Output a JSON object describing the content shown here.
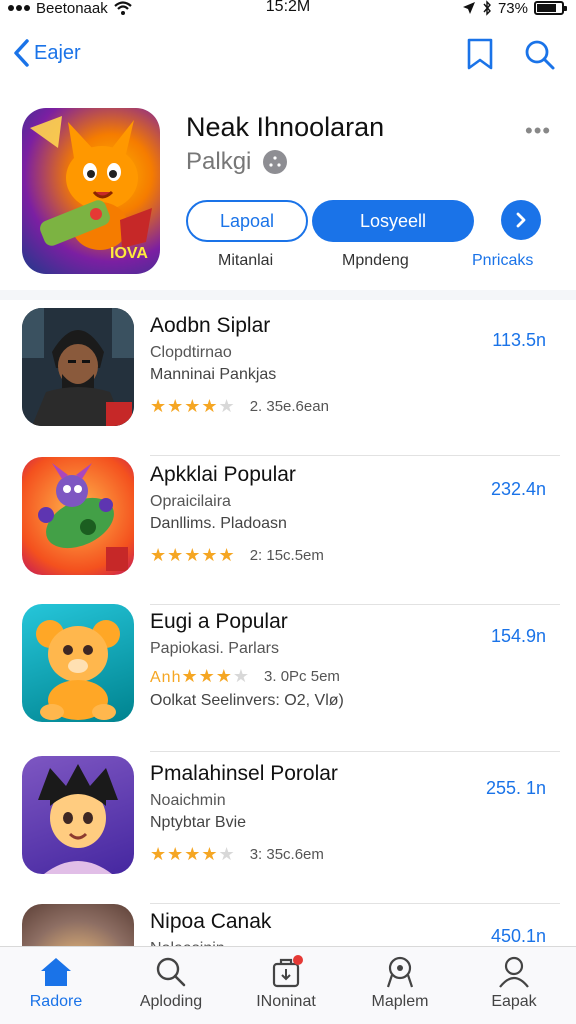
{
  "status": {
    "carrier": "Beetonaak",
    "time": "15:2M",
    "battery": "73%"
  },
  "nav": {
    "back_label": "Eajer",
    "icons": [
      "chevron-left-icon",
      "bookmark-icon",
      "search-icon"
    ]
  },
  "featured": {
    "title": "Neak Ihnoolaran",
    "subtitle": "Palkgi",
    "more": "•••",
    "button_outline": "Lapoal",
    "button_filled": "Losyeell",
    "labels": [
      "Mitanlai",
      "Mpndeng",
      "Pnricaks"
    ]
  },
  "apps": [
    {
      "name": "Aodbn Siplar",
      "line1": "Clopdtirnao",
      "line2": "Manninai Pankjas",
      "stars_prefix": "",
      "rating_text": "2. 35e.6ean",
      "size": "113.5n",
      "star_count": 4.5
    },
    {
      "name": "Apkklai Popular",
      "line1": "Opraicilaira",
      "line2": "Danllims. Pladoasn",
      "stars_prefix": "",
      "rating_text": "2: 15c.5em",
      "size": "232.4n",
      "star_count": 5
    },
    {
      "name": "Eugi a Popular",
      "line1": "Papiokasi. Parlars",
      "line2": "Oolkat Seelinvers: O2, Vlø)",
      "stars_prefix": "Anh",
      "rating_text": "3. 0Pc 5em",
      "size": "154.9n",
      "star_count": 4
    },
    {
      "name": "Pmalahinsel Porolar",
      "line1": "Noaichmin",
      "line2": "Nptybtar Bvie",
      "stars_prefix": "",
      "rating_text": "3: 35c.6em",
      "size": "255. 1n",
      "star_count": 4.5
    },
    {
      "name": "Nipoa Canak",
      "line1": "Nolaasinin",
      "line2": "",
      "stars_prefix": "",
      "rating_text": "",
      "size": "450.1n",
      "star_count": 0
    }
  ],
  "tabs": [
    {
      "label": "Radore",
      "icon": "home-icon",
      "active": true
    },
    {
      "label": "Aploding",
      "icon": "search-icon",
      "active": false
    },
    {
      "label": "INoninat",
      "icon": "bag-icon",
      "active": false
    },
    {
      "label": "Maplem",
      "icon": "pin-icon",
      "active": false
    },
    {
      "label": "Eapak",
      "icon": "person-icon",
      "active": false
    }
  ],
  "colors": {
    "accent": "#1a73e8",
    "star": "#f5a623",
    "badge": "#e53935"
  }
}
